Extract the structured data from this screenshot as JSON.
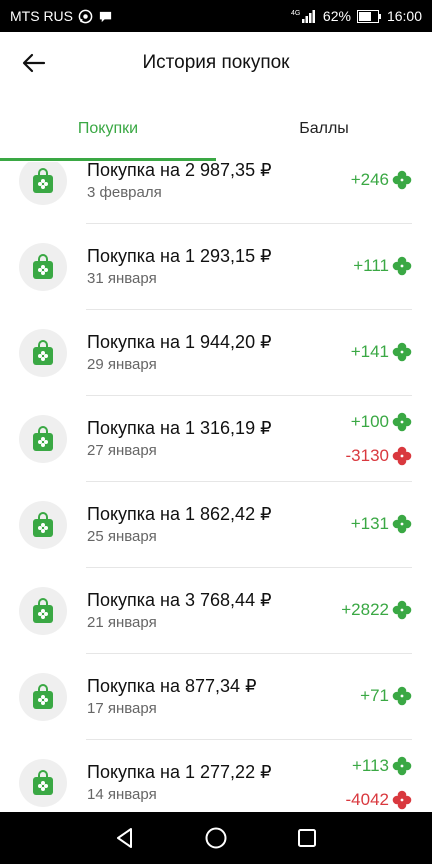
{
  "status_bar": {
    "carrier": "MTS RUS",
    "network": "4G",
    "battery": "62%",
    "time": "16:00"
  },
  "header": {
    "title": "История покупок"
  },
  "tabs": [
    {
      "label": "Покупки",
      "active": true
    },
    {
      "label": "Баллы",
      "active": false
    }
  ],
  "purchases": [
    {
      "title": "Покупка на 2 987,35 ₽",
      "date": "3 февраля",
      "points": [
        "+246"
      ]
    },
    {
      "title": "Покупка на 1 293,15 ₽",
      "date": "31 января",
      "points": [
        "+111"
      ]
    },
    {
      "title": "Покупка на 1 944,20 ₽",
      "date": "29 января",
      "points": [
        "+141"
      ]
    },
    {
      "title": "Покупка на 1 316,19 ₽",
      "date": "27 января",
      "points": [
        "+100",
        "-3130"
      ]
    },
    {
      "title": "Покупка на 1 862,42 ₽",
      "date": "25 января",
      "points": [
        "+131"
      ]
    },
    {
      "title": "Покупка на 3 768,44 ₽",
      "date": "21 января",
      "points": [
        "+2822"
      ]
    },
    {
      "title": "Покупка на 877,34 ₽",
      "date": "17 января",
      "points": [
        "+71"
      ]
    },
    {
      "title": "Покупка на 1 277,22 ₽",
      "date": "14 января",
      "points": [
        "+113",
        "-4042"
      ]
    }
  ],
  "colors": {
    "accent": "#3aa844",
    "negative": "#d9383e",
    "status_bar": "#000000"
  },
  "icons": {
    "row_icon": "shopping-bag-icon",
    "points_icon": "clover-icon",
    "back": "arrow-left-icon",
    "nav": [
      "back-triangle-icon",
      "home-circle-icon",
      "recents-square-icon"
    ]
  }
}
